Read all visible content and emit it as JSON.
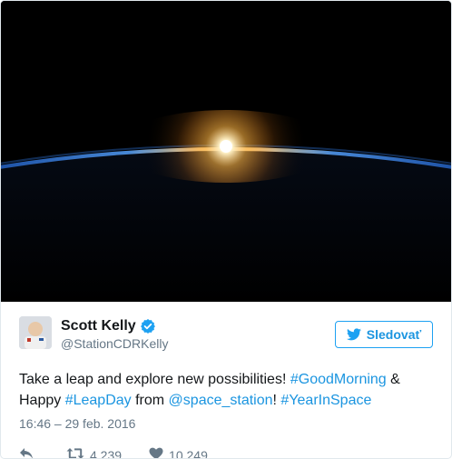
{
  "tweet": {
    "display_name": "Scott Kelly",
    "handle": "@StationCDRKelly",
    "follow_label": "Sledovať",
    "text": {
      "part1": "Take a leap and explore new possibilities! ",
      "tag1": "#GoodMorning",
      "part2": " & Happy ",
      "tag2": "#LeapDay",
      "part3": " from ",
      "mention": "@space_station",
      "part4": "! ",
      "tag3": "#YearInSpace"
    },
    "timestamp": "16:46 – 29 feb. 2016",
    "retweets": "4 239",
    "likes": "10 249"
  },
  "colors": {
    "link": "#1b95e0",
    "muted": "#657786",
    "verified": "#1da1f2"
  },
  "icons": {
    "reply": "reply-icon",
    "retweet": "retweet-icon",
    "like": "heart-icon",
    "verified": "verified-badge-icon",
    "follow": "twitter-bird-icon"
  }
}
